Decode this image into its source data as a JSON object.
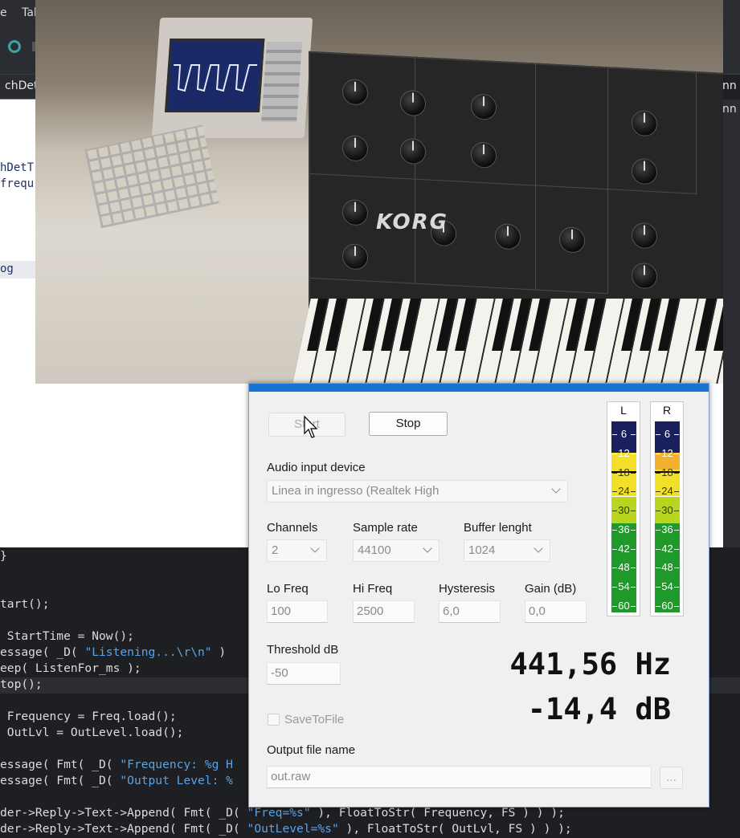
{
  "ide": {
    "menu": [
      "e",
      "Tab"
    ],
    "tab_left": "chDete",
    "tab_right": "nn",
    "right_panel": [
      "nn"
    ],
    "form_texts": [
      "hDetT",
      "frequ",
      "og"
    ],
    "brace": "}",
    "code_lines": [
      {
        "text": "tart();"
      },
      {
        "text": ""
      },
      {
        "text": " StartTime = Now();"
      },
      {
        "pre": "essage( _D( ",
        "str": "\"Listening...\\r\\n\"",
        "post": " )"
      },
      {
        "text": "eep( ListenFor_ms );"
      },
      {
        "text": "top();"
      },
      {
        "text": ""
      },
      {
        "text": " Frequency = Freq.load();"
      },
      {
        "text": " OutLvl = OutLevel.load();"
      },
      {
        "text": ""
      },
      {
        "pre": "essage( Fmt( _D( ",
        "str": "\"Frequency: %g H",
        "post": ""
      },
      {
        "pre": "essage( Fmt( _D( ",
        "str": "\"Output Level: %",
        "post": ""
      },
      {
        "text": ""
      },
      {
        "pre": "der->Reply->Text->Append( Fmt( _D( ",
        "str": "\"Freq=%s\"",
        "post": " ), FloatToStr( Frequency, FS ) ) );"
      },
      {
        "pre": "der->Reply->Text->Append( Fmt( _D( ",
        "str": "\"OutLevel=%s\"",
        "post": " ), FloatToStr( OutLvl, FS ) ) );"
      }
    ]
  },
  "video": {
    "brand": "KORG"
  },
  "dialog": {
    "start_label": "Start",
    "stop_label": "Stop",
    "audio_device_label": "Audio input device",
    "audio_device_value": "Linea in ingresso (Realtek High",
    "channels_label": "Channels",
    "channels_value": "2",
    "sample_rate_label": "Sample rate",
    "sample_rate_value": "44100",
    "buffer_label": "Buffer lenght",
    "buffer_value": "1024",
    "lo_freq_label": "Lo Freq",
    "lo_freq_value": "100",
    "hi_freq_label": "Hi Freq",
    "hi_freq_value": "2500",
    "hysteresis_label": "Hysteresis",
    "hysteresis_value": "6,0",
    "gain_label": "Gain (dB)",
    "gain_value": "0,0",
    "threshold_label": "Threshold dB",
    "threshold_value": "-50",
    "frequency_readout": "441,56 Hz",
    "level_readout": "-14,4 dB",
    "save_to_file_label": "SaveToFile",
    "save_to_file_checked": false,
    "output_file_label": "Output file name",
    "output_file_value": "out.raw",
    "browse_label": "...",
    "meters": {
      "left_label": "L",
      "right_label": "R",
      "ticks": [
        "6",
        "12",
        "18",
        "24",
        "30",
        "36",
        "42",
        "48",
        "54",
        "60"
      ],
      "left_level_fraction": 0.74,
      "right_level_fraction": 0.74,
      "colors": {
        "navy": "#1a1f5e",
        "yellow": "#f2df2a",
        "lime": "#b8d520",
        "green": "#1f9a2a",
        "amber": "#f2b22e"
      }
    }
  }
}
